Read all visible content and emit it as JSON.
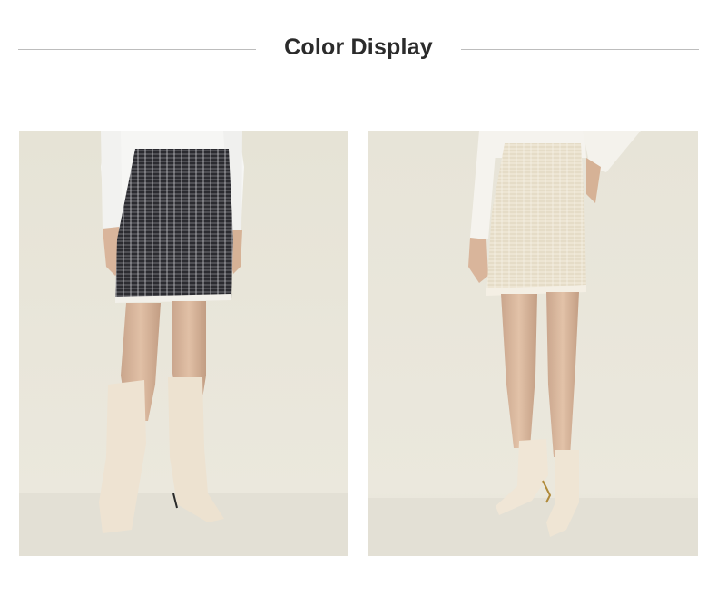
{
  "header": {
    "title": "Color Display"
  },
  "gallery": [
    {
      "variant": "black-tweed-skirt",
      "colors": {
        "skirt": "#2a2a2e",
        "trim": "#f2f0ea",
        "background": "#e9e6da"
      }
    },
    {
      "variant": "ivory-tweed-skirt",
      "colors": {
        "skirt": "#ece4d2",
        "trim": "#f4efe4",
        "background": "#e9e6da"
      }
    }
  ]
}
